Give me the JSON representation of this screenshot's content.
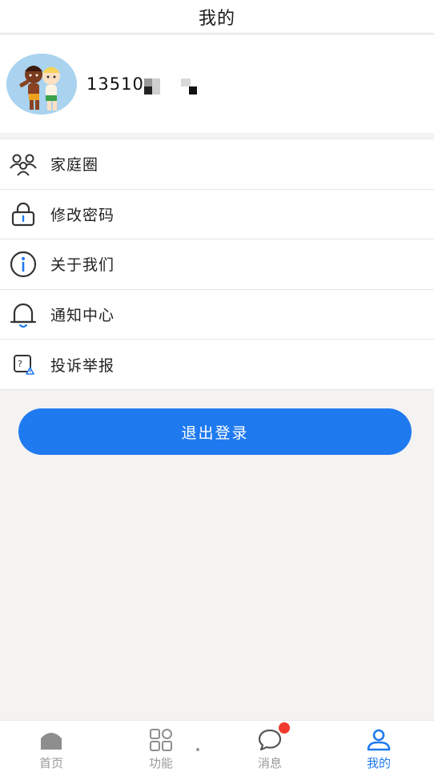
{
  "header": {
    "title": "我的"
  },
  "profile": {
    "phone": "13510"
  },
  "menu": [
    {
      "label": "家庭圈",
      "icon": "family-group-icon"
    },
    {
      "label": "修改密码",
      "icon": "lock-icon"
    },
    {
      "label": "关于我们",
      "icon": "info-icon"
    },
    {
      "label": "通知中心",
      "icon": "bell-icon"
    },
    {
      "label": "投诉举报",
      "icon": "report-icon"
    }
  ],
  "logout": {
    "label": "退出登录"
  },
  "tabs": [
    {
      "label": "首页",
      "icon": "home-icon",
      "active": false
    },
    {
      "label": "功能",
      "icon": "apps-grid-icon",
      "active": false
    },
    {
      "label": "消息",
      "icon": "chat-bubble-icon",
      "active": false,
      "badge": true
    },
    {
      "label": "我的",
      "icon": "user-icon",
      "active": true
    }
  ],
  "colors": {
    "accent": "#1f7af0",
    "badge": "#f03a2e",
    "background": "#f4f3f1"
  }
}
